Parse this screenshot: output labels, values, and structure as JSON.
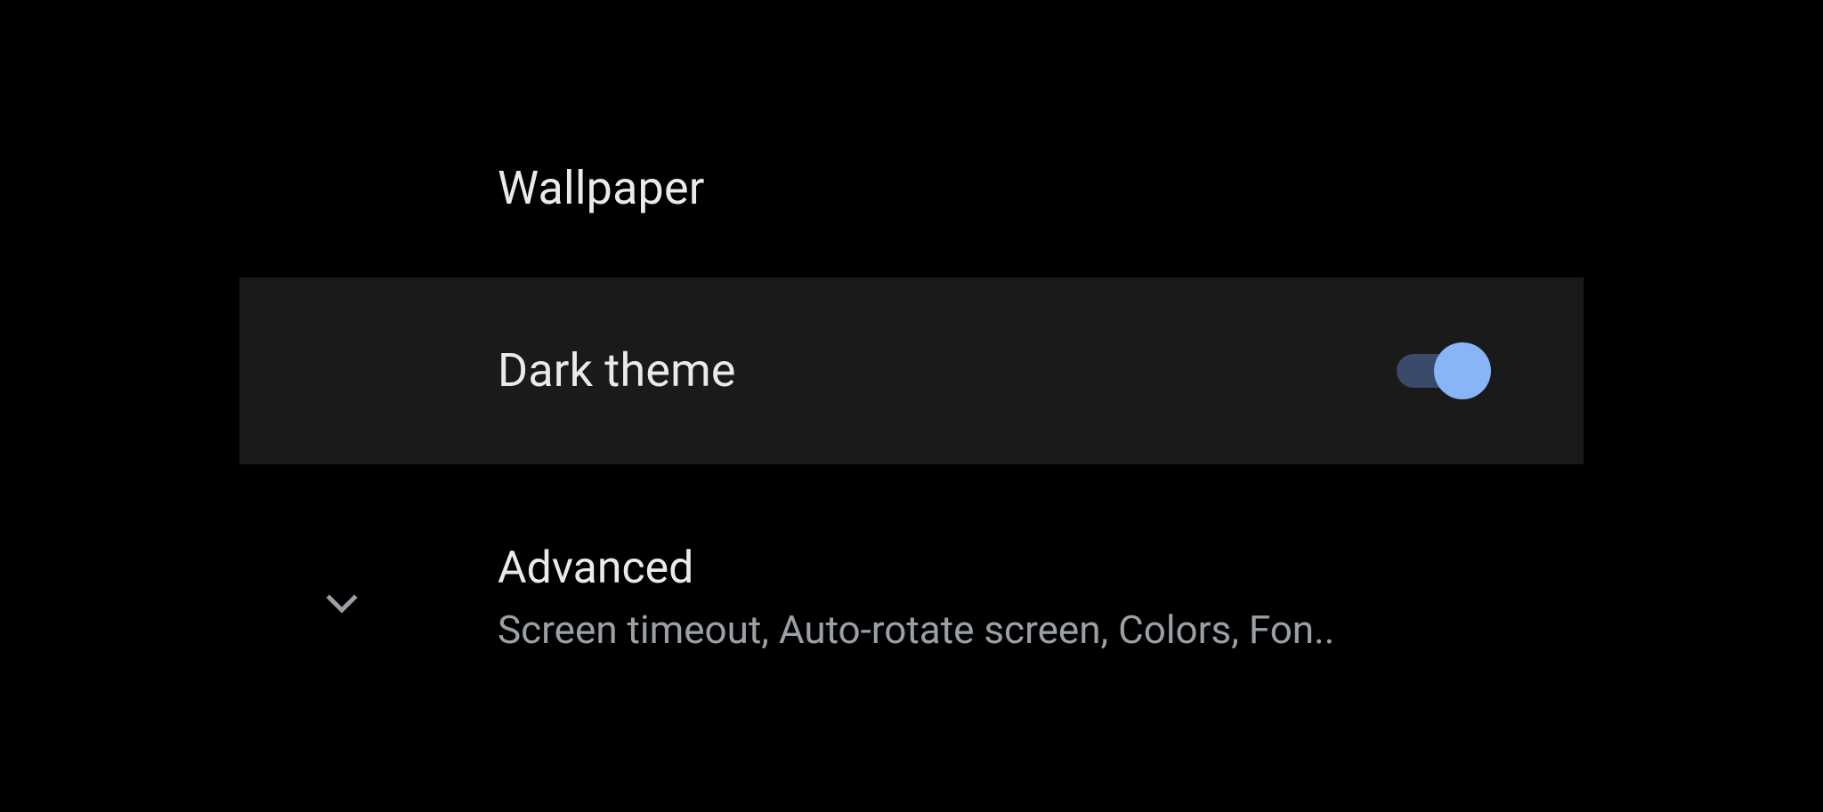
{
  "settings": {
    "items": [
      {
        "label": "Wallpaper"
      },
      {
        "label": "Dark theme",
        "toggle_on": true
      },
      {
        "label": "Advanced",
        "summary": "Screen timeout, Auto-rotate screen, Colors, Fon.."
      }
    ]
  },
  "colors": {
    "accent": "#8ab4f8",
    "track": "#3a4a6b",
    "highlight_row": "#1a1a1a",
    "bg": "#000000",
    "text_primary": "#e8eaed",
    "text_secondary": "#9aa0a6"
  }
}
